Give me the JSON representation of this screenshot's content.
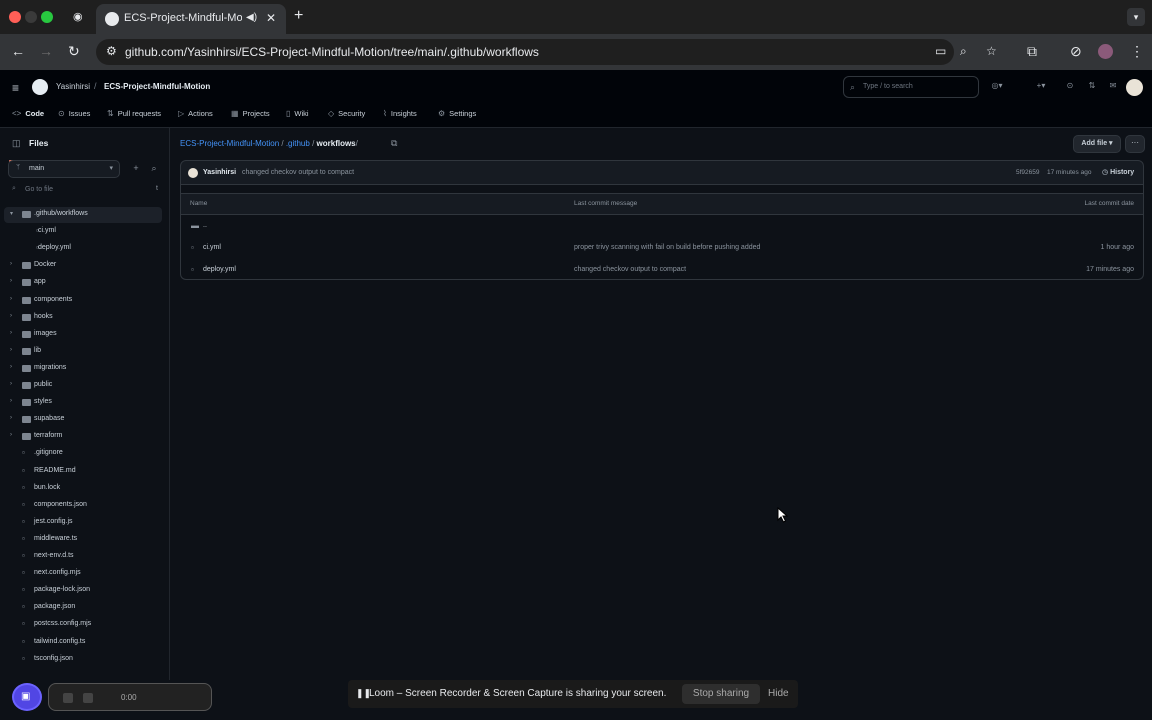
{
  "browser": {
    "tab_title": "ECS-Project-Mindful-Mo",
    "url": "github.com/Yasinhirsi/ECS-Project-Mindful-Motion/tree/main/.github/workflows"
  },
  "header": {
    "owner": "Yasinhirsi",
    "repo": "ECS-Project-Mindful-Motion",
    "search_placeholder": "Type / to search"
  },
  "repo_nav": {
    "items": [
      {
        "label": "Code",
        "icon": "code-icon"
      },
      {
        "label": "Issues",
        "icon": "issues-icon"
      },
      {
        "label": "Pull requests",
        "icon": "pull-request-icon"
      },
      {
        "label": "Actions",
        "icon": "actions-icon"
      },
      {
        "label": "Projects",
        "icon": "projects-icon"
      },
      {
        "label": "Wiki",
        "icon": "wiki-icon"
      },
      {
        "label": "Security",
        "icon": "shield-icon"
      },
      {
        "label": "Insights",
        "icon": "graph-icon"
      },
      {
        "label": "Settings",
        "icon": "gear-icon"
      }
    ]
  },
  "sidebar": {
    "title": "Files",
    "branch": "main",
    "go_to_file": "Go to file",
    "tree": [
      {
        "label": ".github/workflows",
        "type": "folder",
        "open": true,
        "selected": true
      },
      {
        "label": "ci.yml",
        "type": "file",
        "child": true
      },
      {
        "label": "deploy.yml",
        "type": "file",
        "child": true
      },
      {
        "label": "Docker",
        "type": "folder"
      },
      {
        "label": "app",
        "type": "folder"
      },
      {
        "label": "components",
        "type": "folder"
      },
      {
        "label": "hooks",
        "type": "folder"
      },
      {
        "label": "images",
        "type": "folder"
      },
      {
        "label": "lib",
        "type": "folder"
      },
      {
        "label": "migrations",
        "type": "folder"
      },
      {
        "label": "public",
        "type": "folder"
      },
      {
        "label": "styles",
        "type": "folder"
      },
      {
        "label": "supabase",
        "type": "folder"
      },
      {
        "label": "terraform",
        "type": "folder"
      },
      {
        "label": ".gitignore",
        "type": "file"
      },
      {
        "label": "README.md",
        "type": "file"
      },
      {
        "label": "bun.lock",
        "type": "file"
      },
      {
        "label": "components.json",
        "type": "file"
      },
      {
        "label": "jest.config.js",
        "type": "file"
      },
      {
        "label": "middleware.ts",
        "type": "file"
      },
      {
        "label": "next-env.d.ts",
        "type": "file"
      },
      {
        "label": "next.config.mjs",
        "type": "file"
      },
      {
        "label": "package-lock.json",
        "type": "file"
      },
      {
        "label": "package.json",
        "type": "file"
      },
      {
        "label": "postcss.config.mjs",
        "type": "file"
      },
      {
        "label": "tailwind.config.ts",
        "type": "file"
      },
      {
        "label": "tsconfig.json",
        "type": "file"
      }
    ]
  },
  "main": {
    "breadcrumb": {
      "repo": "ECS-Project-Mindful-Motion",
      "dir": ".github",
      "current": "workflows",
      "trail": "/"
    },
    "add_file": "Add file",
    "more": "···",
    "commit": {
      "author": "Yasinhirsi",
      "message": "changed checkov output to compact",
      "hash": "5f92659",
      "ago": "17 minutes ago",
      "history": "History"
    },
    "table": {
      "headers": [
        "Name",
        "Last commit message",
        "Last commit date"
      ],
      "rows": [
        {
          "name": "..",
          "type": "parent",
          "message": "",
          "date": ""
        },
        {
          "name": "ci.yml",
          "type": "file",
          "message": "proper trivy scanning with fail on build before pushing added",
          "date": "1 hour ago"
        },
        {
          "name": "deploy.yml",
          "type": "file",
          "message": "changed checkov output to compact",
          "date": "17 minutes ago"
        }
      ]
    }
  },
  "loom": {
    "timer": "0:00",
    "share_text": "Loom – Screen Recorder & Screen Capture is sharing your screen.",
    "stop_sharing": "Stop sharing",
    "hide": "Hide"
  }
}
